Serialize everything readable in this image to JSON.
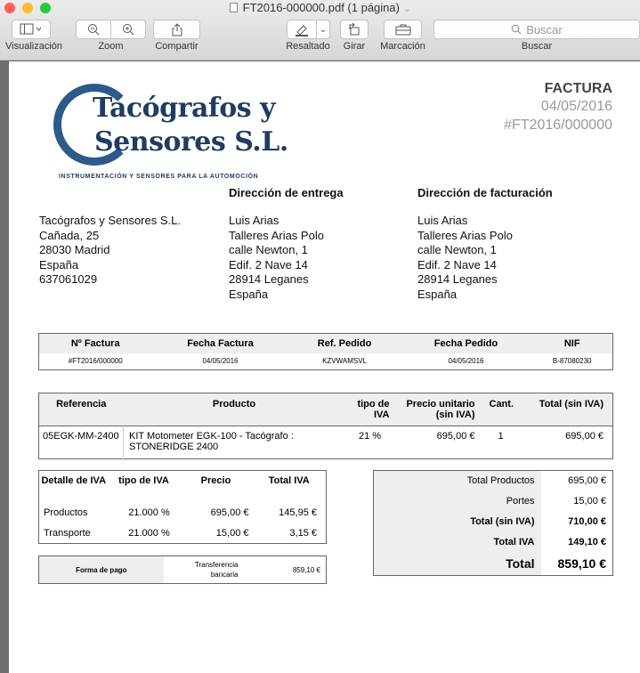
{
  "window": {
    "title": "FT2016-000000.pdf (1 página)",
    "traffic_lights": [
      "#fe5f57",
      "#febc2e",
      "#28c840"
    ]
  },
  "toolbar": {
    "visualizacion": "Visualización",
    "zoom": "Zoom",
    "compartir": "Compartir",
    "resaltado": "Resaltado",
    "girar": "Girar",
    "marcacion": "Marcación",
    "buscar": "Buscar",
    "search_placeholder": "Buscar"
  },
  "invoice": {
    "logo": {
      "line1": "Tacógrafos y",
      "line2": "Sensores S.L.",
      "tagline": "INSTRUMENTACIÓN Y SENSORES PARA LA AUTOMOCIÓN"
    },
    "title": "FACTURA",
    "date": "04/05/2016",
    "number": "#FT2016/000000",
    "company": {
      "line1": "Tacógrafos y Sensores S.L.",
      "line2": "Cañada, 25",
      "line3": "28030 Madrid",
      "line4": "España",
      "line5": "637061029"
    },
    "delivery": {
      "heading": "Dirección de entrega",
      "line1": "Luis Arias",
      "line2": "Talleres Arias Polo",
      "line3": "calle Newton, 1",
      "line4": "Edif. 2 Nave 14",
      "line5": "28914 Leganes",
      "line6": "España"
    },
    "billing": {
      "heading": "Dirección de facturación",
      "line1": "Luis Arias",
      "line2": "Talleres Arias Polo",
      "line3": "calle Newton, 1",
      "line4": "Edif. 2 Nave 14",
      "line5": "28914 Leganes",
      "line6": "España"
    },
    "info_table": {
      "headers": [
        "Nº Factura",
        "Fecha Factura",
        "Ref. Pedido",
        "Fecha Pedido",
        "NIF"
      ],
      "row": [
        "#FT2016/000000",
        "04/05/2016",
        "KZVWAMSVL",
        "04/05/2016",
        "B-87080230"
      ]
    },
    "items_table": {
      "headers": [
        "Referencia",
        "Producto",
        "tipo de IVA",
        "Precio unitario (sin IVA)",
        "Cant.",
        "Total (sin IVA)"
      ],
      "rows": [
        [
          "05EGK-MM-2400",
          "KIT Motometer EGK-100 - Tacógrafo : STONERIDGE 2400",
          "21 %",
          "695,00 €",
          "1",
          "695,00 €"
        ]
      ]
    },
    "tax_table": {
      "headers": [
        "Detalle de IVA",
        "tipo de IVA",
        "Precio",
        "Total IVA"
      ],
      "rows": [
        [
          "Productos",
          "21.000 %",
          "695,00 €",
          "145,95 €"
        ],
        [
          "Transporte",
          "21.000 %",
          "15,00 €",
          "3,15 €"
        ]
      ]
    },
    "totals": [
      [
        "Total Productos",
        "695,00 €"
      ],
      [
        "Portes",
        "15,00 €"
      ],
      [
        "Total (sin IVA)",
        "710,00 €"
      ],
      [
        "Total IVA",
        "149,10 €"
      ],
      [
        "Total",
        "859,10 €"
      ]
    ],
    "payment": {
      "label": "Forma de pago",
      "method_line1": "Transferencia",
      "method_line2": "bancaria",
      "amount": "859,10 €"
    }
  }
}
